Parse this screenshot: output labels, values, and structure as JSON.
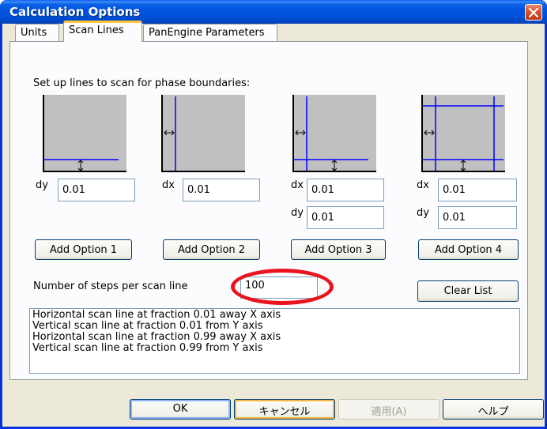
{
  "window": {
    "title": "Calculation Options"
  },
  "tabs": [
    {
      "label": "Units"
    },
    {
      "label": "Scan Lines"
    },
    {
      "label": "PanEngine Parameters"
    }
  ],
  "panel": {
    "heading": "Set up lines to scan for phase boundaries:",
    "options": [
      {
        "button": "Add Option 1",
        "fields": [
          {
            "label": "dy",
            "value": "0.01"
          }
        ]
      },
      {
        "button": "Add Option 2",
        "fields": [
          {
            "label": "dx",
            "value": "0.01"
          }
        ]
      },
      {
        "button": "Add Option 3",
        "fields": [
          {
            "label": "dx",
            "value": "0.01"
          },
          {
            "label": "dy",
            "value": "0.01"
          }
        ]
      },
      {
        "button": "Add Option 4",
        "fields": [
          {
            "label": "dx",
            "value": "0.01"
          },
          {
            "label": "dy",
            "value": "0.01"
          }
        ]
      }
    ],
    "steps_label": "Number of steps per scan line",
    "steps_value": "100",
    "clear_button": "Clear List",
    "scan_list": [
      "Horizontal scan line at fraction 0.01 away X axis",
      "Vertical scan line at fraction 0.01 from Y axis",
      "Horizontal scan line at fraction 0.99 away X axis",
      "Vertical scan line at fraction 0.99 from Y axis"
    ]
  },
  "buttons": {
    "ok": "OK",
    "cancel": "キャンセル",
    "apply": "適用(A)",
    "help": "ヘルプ"
  },
  "colors": {
    "scan_line": "#0000ff",
    "annotation": "#e8141e",
    "titlebar": "#0054e3"
  }
}
